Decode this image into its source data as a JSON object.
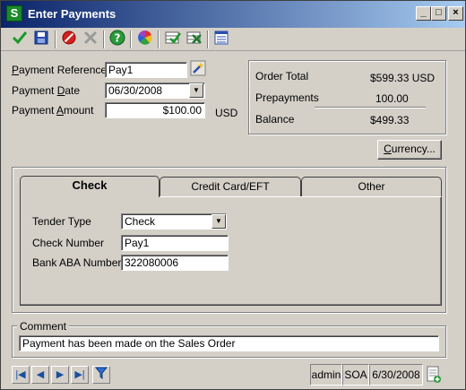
{
  "window": {
    "title": "Enter Payments",
    "app_icon_letter": "S",
    "minimize_glyph": "_",
    "maximize_glyph": "□",
    "close_glyph": "×"
  },
  "toolbar": {
    "icons": [
      "accept-check-icon",
      "save-disk-icon",
      "cancel-icon",
      "delete-x-icon",
      "help-icon",
      "color-wheel-icon",
      "accept-grid-icon",
      "delete-grid-icon",
      "list-icon"
    ]
  },
  "form": {
    "payment_reference_label_u": "P",
    "payment_reference_label_rest": "ayment Reference",
    "payment_reference_value": "Pay1",
    "payment_date_label_pre": "Payment ",
    "payment_date_label_u": "D",
    "payment_date_label_rest": "ate",
    "payment_date_value": "06/30/2008",
    "payment_amount_label_pre": "Payment ",
    "payment_amount_label_u": "A",
    "payment_amount_label_rest": "mount",
    "payment_amount_value": "$100.00",
    "currency_code": "USD"
  },
  "summary": {
    "order_total_label": "Order Total",
    "order_total_value": "$599.33 USD",
    "prepayments_label": "Prepayments",
    "prepayments_value": "100.00",
    "balance_label": "Balance",
    "balance_value": "$499.33"
  },
  "currency_button": {
    "label_u": "C",
    "label_rest": "urrency..."
  },
  "tabs": [
    {
      "label": "Check",
      "active": true
    },
    {
      "label": "Credit Card/EFT",
      "active": false
    },
    {
      "label": "Other",
      "active": false
    }
  ],
  "check_tab": {
    "tender_type_label": "Tender Type",
    "tender_type_value": "Check",
    "check_number_label": "Check Number",
    "check_number_value": "Pay1",
    "bank_aba_label": "Bank ABA Number",
    "bank_aba_value": "322080006"
  },
  "comment": {
    "label": "Comment",
    "value": "Payment has been made on the Sales Order"
  },
  "statusbar": {
    "user": "admin",
    "company": "SOA",
    "date": "6/30/2008"
  },
  "colors": {
    "title_gradient_start": "#0a246a",
    "title_gradient_end": "#a6caf0",
    "face": "#d4d0c8",
    "nav_blue": "#1a4fa0"
  }
}
